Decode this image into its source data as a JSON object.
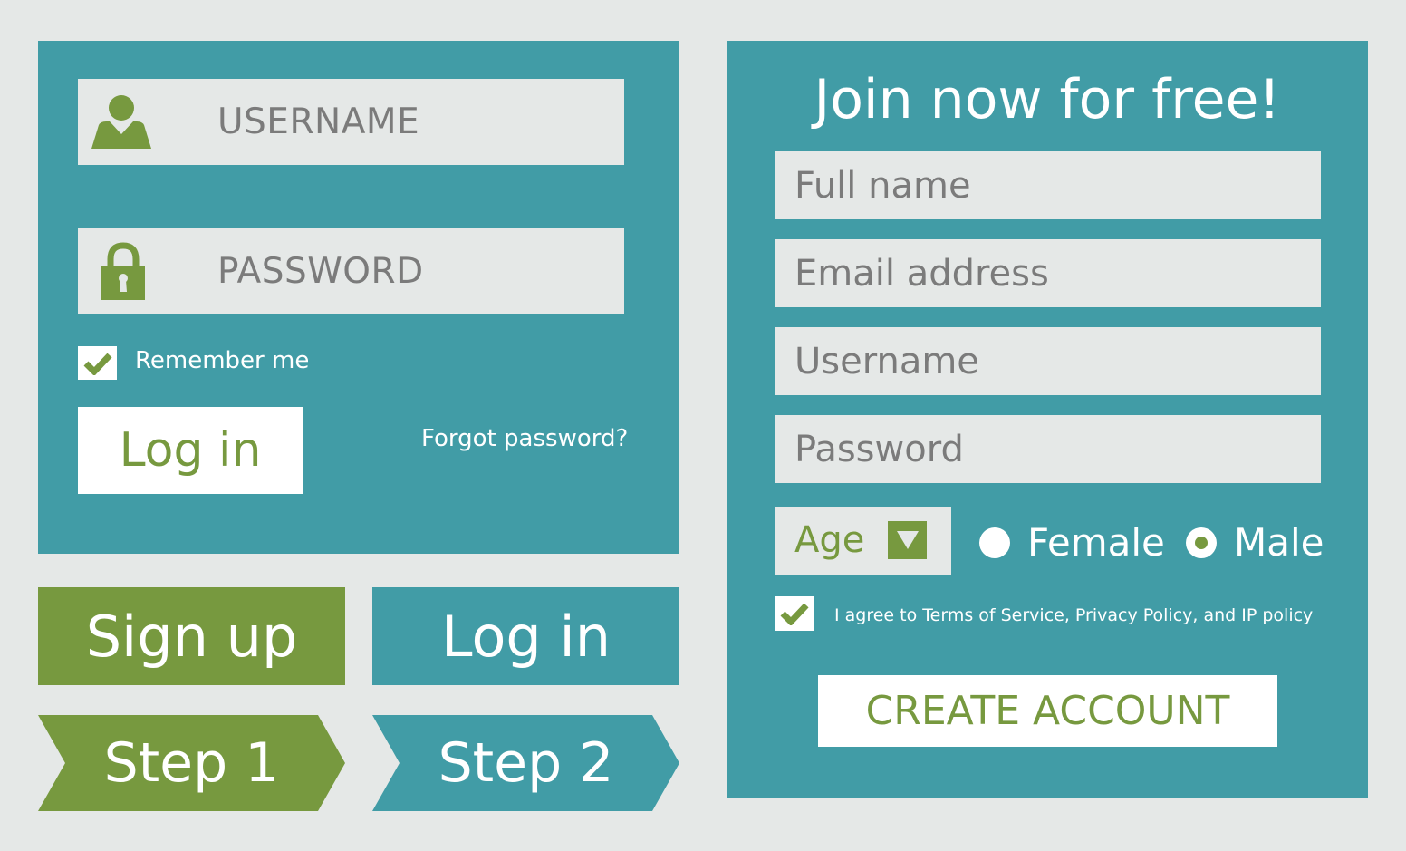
{
  "colors": {
    "teal": "#419ca6",
    "green": "#77993f",
    "light_gray": "#e5e8e7",
    "placeholder_gray": "#7b7b7b",
    "white": "#ffffff"
  },
  "login_panel": {
    "username_placeholder": "USERNAME",
    "username_icon": "user-icon",
    "password_placeholder": "PASSWORD",
    "password_icon": "lock-icon",
    "remember_me_label": "Remember me",
    "remember_me_checked": true,
    "login_button_label": "Log in",
    "forgot_password_link": "Forgot password?"
  },
  "buttons": {
    "signup_label": "Sign up",
    "login_label": "Log in"
  },
  "steps": [
    {
      "label": "Step 1",
      "color": "green"
    },
    {
      "label": "Step 2",
      "color": "teal"
    }
  ],
  "register_panel": {
    "title": "Join now for free!",
    "full_name_placeholder": "Full name",
    "email_placeholder": "Email address",
    "username_placeholder": "Username",
    "password_placeholder": "Password",
    "age_select_label": "Age",
    "gender_options": [
      {
        "label": "Female",
        "selected": false
      },
      {
        "label": "Male",
        "selected": true
      }
    ],
    "terms_label": "I agree to Terms of Service, Privacy Policy, and IP policy",
    "terms_checked": true,
    "create_account_label": "CREATE ACCOUNT"
  }
}
